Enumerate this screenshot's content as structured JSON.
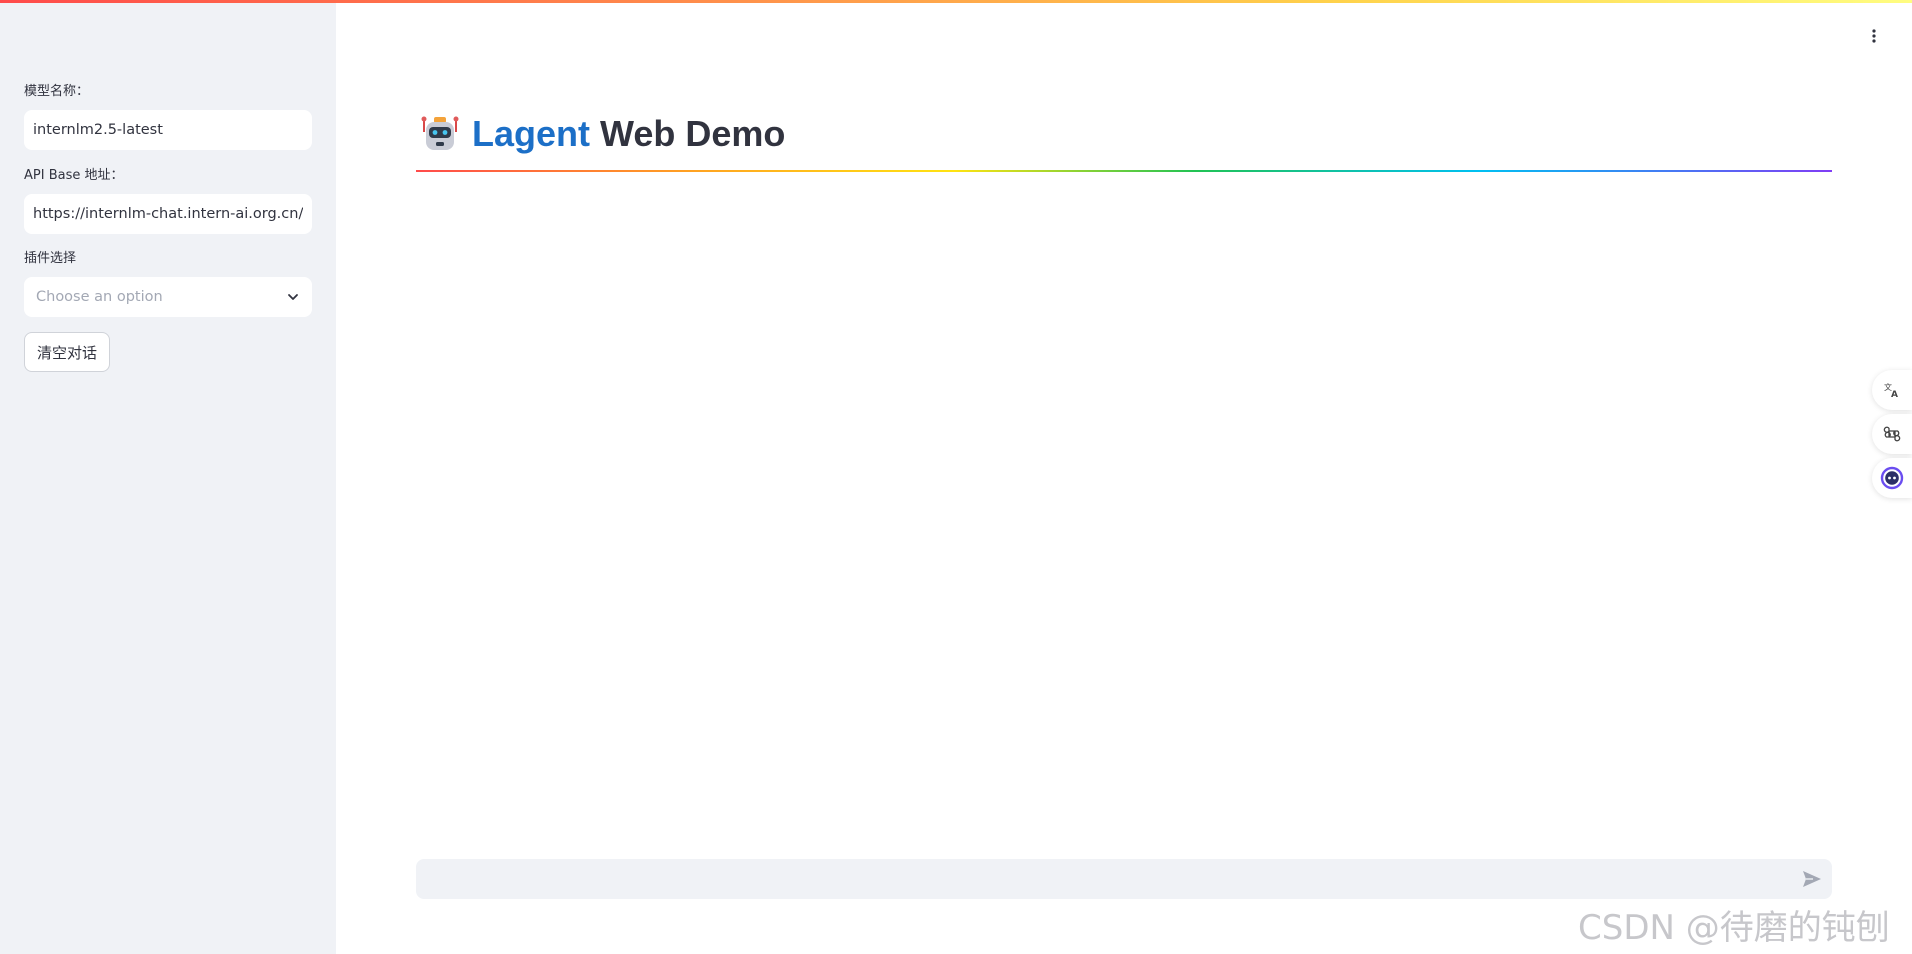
{
  "sidebar": {
    "model_name": {
      "label": "模型名称：",
      "value": "internlm2.5-latest"
    },
    "api_base": {
      "label": "API Base 地址：",
      "value": "https://internlm-chat.intern-ai.org.cn/pu"
    },
    "plugin": {
      "label": "插件选择",
      "placeholder": "Choose an option"
    },
    "clear_button_label": "清空对话"
  },
  "header": {
    "title_accent": "Lagent",
    "title_rest": " Web Demo"
  },
  "chat": {
    "input_value": ""
  },
  "watermark": "CSDN @待磨的钝刨",
  "colors": {
    "title_accent": "#1c6fc7",
    "sidebar_bg": "#f0f2f6"
  },
  "icons": {
    "menu": "more-vertical-icon",
    "send": "send-icon",
    "robot": "robot-icon",
    "chevron": "chevron-down-icon",
    "float_tools": [
      "translate-icon",
      "command-icon",
      "assistant-icon"
    ]
  }
}
